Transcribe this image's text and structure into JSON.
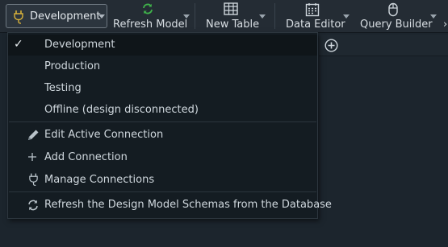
{
  "toolbar": {
    "connection": {
      "label": "Development",
      "icon": "plug-icon"
    },
    "buttons": [
      {
        "label": "Refresh Model",
        "icon": "refresh-icon"
      },
      {
        "label": "New Table",
        "icon": "table-icon"
      },
      {
        "label": "Data Editor",
        "icon": "data-editor-icon"
      },
      {
        "label": "Query Builder",
        "icon": "mouse-icon"
      }
    ]
  },
  "menu": {
    "connections": [
      {
        "label": "Development",
        "checked": true
      },
      {
        "label": "Production",
        "checked": false
      },
      {
        "label": "Testing",
        "checked": false
      },
      {
        "label": "Offline (design disconnected)",
        "checked": false
      }
    ],
    "actions": [
      {
        "label": "Edit Active Connection",
        "icon": "pencil-icon"
      },
      {
        "label": "Add Connection",
        "icon": "plus-icon"
      },
      {
        "label": "Manage Connections",
        "icon": "plug-icon"
      }
    ],
    "refresh": {
      "label": "Refresh the Design Model Schemas from the Database",
      "icon": "refresh-icon"
    }
  },
  "colors": {
    "background": "#1c252d",
    "menu_bg": "#141c22",
    "refresh_icon": "#3fb24a",
    "plug_icon": "#d8b23a"
  }
}
